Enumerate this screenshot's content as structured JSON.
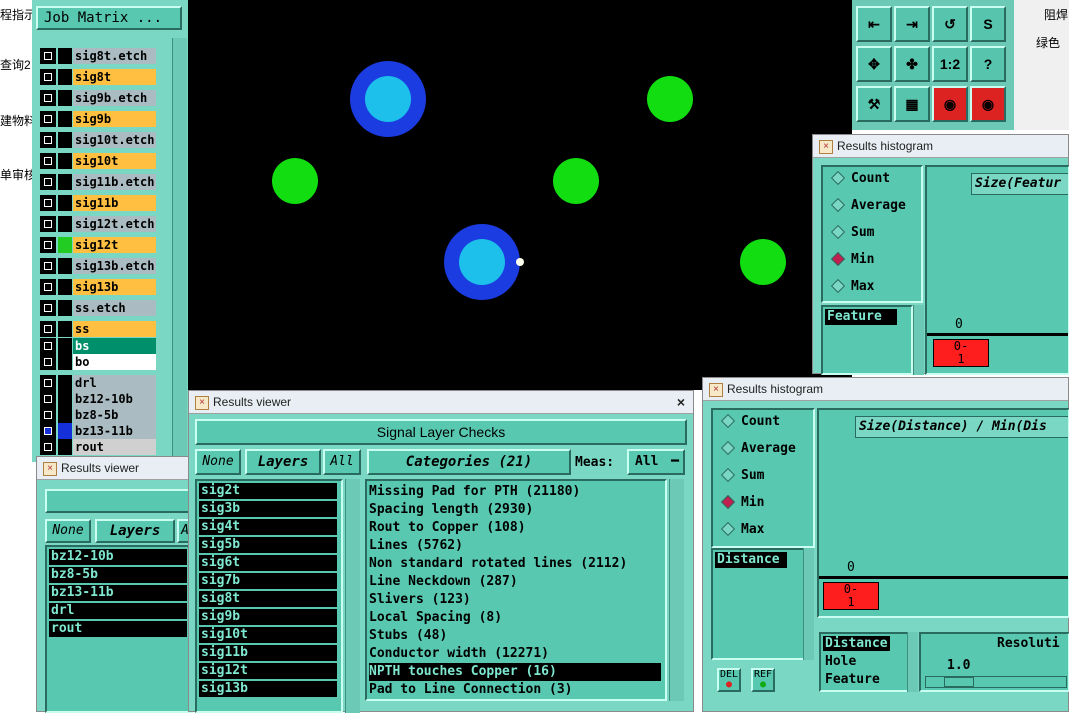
{
  "desktop_labels": [
    "程指示",
    "查询2",
    "建物料",
    "单审核"
  ],
  "job_matrix": {
    "label": "Job Matrix ..."
  },
  "layers": [
    {
      "name": "sig8t.etch",
      "bg": "#aabcc2",
      "color": null,
      "checked": false
    },
    {
      "name": "sig8t",
      "bg": "#ffbf40",
      "color": null,
      "checked": false
    },
    {
      "name": "sig9b.etch",
      "bg": "#aabcc2",
      "color": null,
      "checked": false
    },
    {
      "name": "sig9b",
      "bg": "#ffbf40",
      "color": null,
      "checked": false
    },
    {
      "name": "sig10t.etch",
      "bg": "#aabcc2",
      "color": null,
      "checked": false
    },
    {
      "name": "sig10t",
      "bg": "#ffbf40",
      "color": null,
      "checked": false
    },
    {
      "name": "sig11b.etch",
      "bg": "#aabcc2",
      "color": null,
      "checked": false
    },
    {
      "name": "sig11b",
      "bg": "#ffbf40",
      "color": null,
      "checked": false
    },
    {
      "name": "sig12t.etch",
      "bg": "#aabcc2",
      "color": null,
      "checked": false
    },
    {
      "name": "sig12t",
      "bg": "#ffbf40",
      "color": "#22cc22",
      "checked": false
    },
    {
      "name": "sig13b.etch",
      "bg": "#aabcc2",
      "color": null,
      "checked": false
    },
    {
      "name": "sig13b",
      "bg": "#ffbf40",
      "color": null,
      "checked": false
    },
    {
      "name": "ss.etch",
      "bg": "#aabcc2",
      "color": null,
      "checked": false
    },
    {
      "name": "ss",
      "bg": "#ffbf40",
      "color": null,
      "checked": false
    },
    {
      "name": "bs",
      "bg": "#008f6b",
      "color": null,
      "checked": false
    },
    {
      "name": "bo",
      "bg": "#ffffff",
      "color": null,
      "checked": false
    },
    {
      "name": "drl",
      "bg": "#aabcc2",
      "color": null,
      "checked": false
    },
    {
      "name": "bz12-10b",
      "bg": "#aabcc2",
      "color": null,
      "checked": false
    },
    {
      "name": "bz8-5b",
      "bg": "#aabcc2",
      "color": null,
      "checked": false
    },
    {
      "name": "bz13-11b",
      "bg": "#aabcc2",
      "color": "#1530d8",
      "checked": true
    },
    {
      "name": "rout",
      "bg": "#d0d0d0",
      "color": null,
      "checked": false
    }
  ],
  "toolbar_icons": [
    "zoom-in-icon",
    "zoom-out-icon",
    "undo-zoom-icon",
    "fit-icon",
    "center-icon",
    "pan-icon",
    "ratio-icon",
    "help-icon",
    "measure-icon",
    "grid-icon",
    "layer-red-icon-1",
    "layer-red-icon-2"
  ],
  "toolbar_texts": {
    "ratio": "1:2",
    "help": "?"
  },
  "right_strip": {
    "text1": "阻焊",
    "text2": "绿色"
  },
  "results_viewer_small": {
    "title": "Results viewer",
    "none_label": "None",
    "layers_label": "Layers",
    "all_label": "A",
    "items": [
      "bz12-10b",
      "bz8-5b",
      "bz13-11b",
      "drl",
      "rout"
    ]
  },
  "results_viewer_main": {
    "title": "Results viewer",
    "close": "×",
    "header": "Signal Layer Checks",
    "none_label": "None",
    "layers_label": "Layers",
    "all_label": "All",
    "categories_label": "Categories (21)",
    "meas_label": "Meas:",
    "meas_value": "All",
    "layers": [
      "sig2t",
      "sig3b",
      "sig4t",
      "sig5b",
      "sig6t",
      "sig7b",
      "sig8t",
      "sig9b",
      "sig10t",
      "sig11b",
      "sig12t",
      "sig13b"
    ],
    "categories": [
      {
        "text": "Missing Pad for PTH (21180)",
        "selected": false
      },
      {
        "text": "Spacing length (2930)",
        "selected": false
      },
      {
        "text": "Rout to Copper (108)",
        "selected": false
      },
      {
        "text": "Lines (5762)",
        "selected": false
      },
      {
        "text": "Non standard rotated lines (2112)",
        "selected": false
      },
      {
        "text": "Line Neckdown (287)",
        "selected": false
      },
      {
        "text": "Slivers (123)",
        "selected": false
      },
      {
        "text": "Local Spacing (8)",
        "selected": false
      },
      {
        "text": "Stubs (48)",
        "selected": false
      },
      {
        "text": "Conductor width (12271)",
        "selected": false
      },
      {
        "text": "NPTH touches Copper (16)",
        "selected": true
      },
      {
        "text": "Pad to Line Connection (3)",
        "selected": false
      }
    ]
  },
  "histogram_top": {
    "title": "Results histogram",
    "options": [
      "Count",
      "Average",
      "Sum",
      "Min",
      "Max"
    ],
    "selected": "Min",
    "field": "Feature",
    "size_label": "Size(Featur",
    "axis_zero": "0",
    "bar_label": "0-\n1"
  },
  "histogram_bottom": {
    "title": "Results histogram",
    "options": [
      "Count",
      "Average",
      "Sum",
      "Min",
      "Max"
    ],
    "selected": "Min",
    "field": "Distance",
    "size_label": "Size(Distance) / Min(Dis",
    "axis_zero": "0",
    "bar_label": "0-\n1",
    "fields_list": [
      "Distance",
      "Hole",
      "Feature"
    ],
    "resolution_label": "Resoluti",
    "resolution_value": "1.0",
    "del_label": "DEL",
    "ref_label": "REF"
  },
  "colors": {
    "canvas": "#000000",
    "pad_green": "#11dd11",
    "pad_blue_outer": "#1a3ce0",
    "pad_blue_inner": "#1cc0ea",
    "panel": "#7ad7c3"
  }
}
